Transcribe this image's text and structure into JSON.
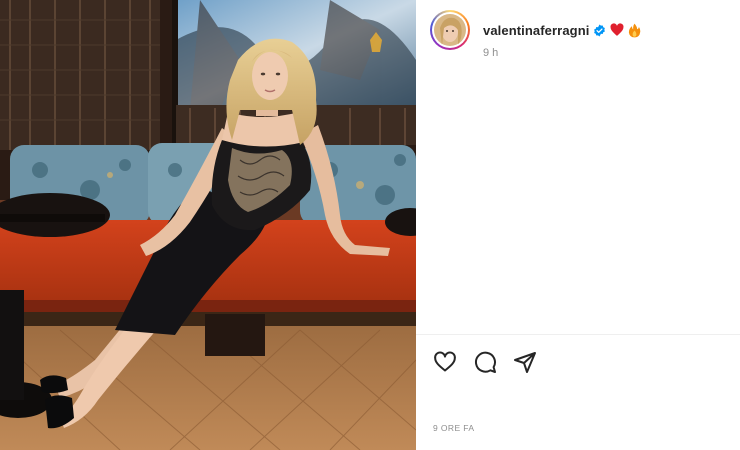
{
  "post": {
    "username": "valentinaferragni",
    "caption_emojis": [
      "red-heart",
      "fire"
    ],
    "time_short": "9 h",
    "time_long": "9 ORE FA"
  },
  "actions": [
    {
      "name": "like-button",
      "icon": "heart-icon"
    },
    {
      "name": "comment-button",
      "icon": "comment-icon"
    },
    {
      "name": "share-button",
      "icon": "paper-plane-icon"
    }
  ],
  "colors": {
    "verified_badge": "#0095f6",
    "heart_emoji": "#e0202e",
    "fire_emoji": "#f4900c",
    "secondary_text": "#8e8e8e"
  }
}
